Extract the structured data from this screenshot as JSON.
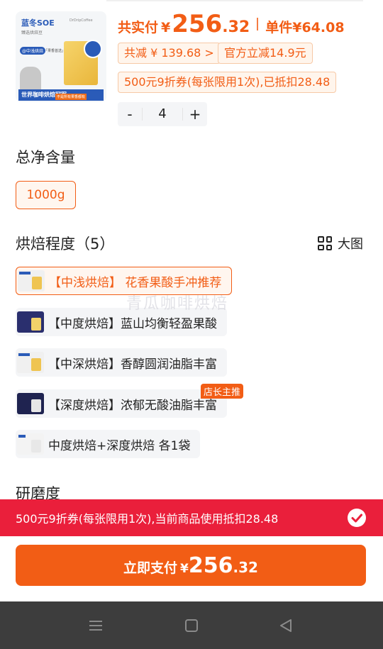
{
  "product": {
    "thumb_brand": "蓝冬SOE",
    "thumb_subtitle": "臻选烘焙豆",
    "thumb_tag": "@中浅烘焙",
    "thumb_tag2": "「果香首选」",
    "thumb_banner": "世界咖啡烘焙冠军",
    "thumb_banner2": "不是所有果香都有",
    "thumb_logo": "DrDripCoffee"
  },
  "price": {
    "total_label": "共实付",
    "currency": "¥",
    "total_int": "256",
    "total_dec": ".32",
    "unit_label": "单件",
    "unit_price": "¥64.08"
  },
  "discounts": {
    "total_reduce": "共减 ¥ 139.68 >",
    "official": "官方立减14.9元",
    "coupon": "500元9折券(每张限用1次),已抵扣28.48"
  },
  "quantity": {
    "minus": "-",
    "value": "4",
    "plus": "+"
  },
  "net_content": {
    "title": "总净含量",
    "options": [
      "1000g"
    ]
  },
  "roast": {
    "title": "烘焙程度（5）",
    "big_view_label": "大图",
    "options": [
      "【中浅烘焙】 花香果酸手冲推荐",
      "【中度烘焙】蓝山均衡轻盈果酸",
      "【中深烘焙】香醇圆润油脂丰富",
      "【深度烘焙】浓郁无酸油脂丰富",
      "中度烘焙+深度烘焙 各1袋"
    ],
    "shop_tag": "店长主推"
  },
  "grind": {
    "title": "研磨度"
  },
  "watermark": "青瓜咖啡烘焙",
  "coupon_bar": {
    "text": "500元9折券(每张限用1次),当前商品使用抵扣28.48"
  },
  "pay": {
    "label": "立即支付",
    "currency": "¥",
    "amount_int": "256",
    "amount_dec": ".32"
  },
  "colors": {
    "accent": "#f25d15",
    "coupon_red": "#ea1f3b",
    "navbar": "#3d3d3d"
  },
  "nav_icons": [
    "menu-icon",
    "home-square-icon",
    "back-triangle-icon"
  ]
}
